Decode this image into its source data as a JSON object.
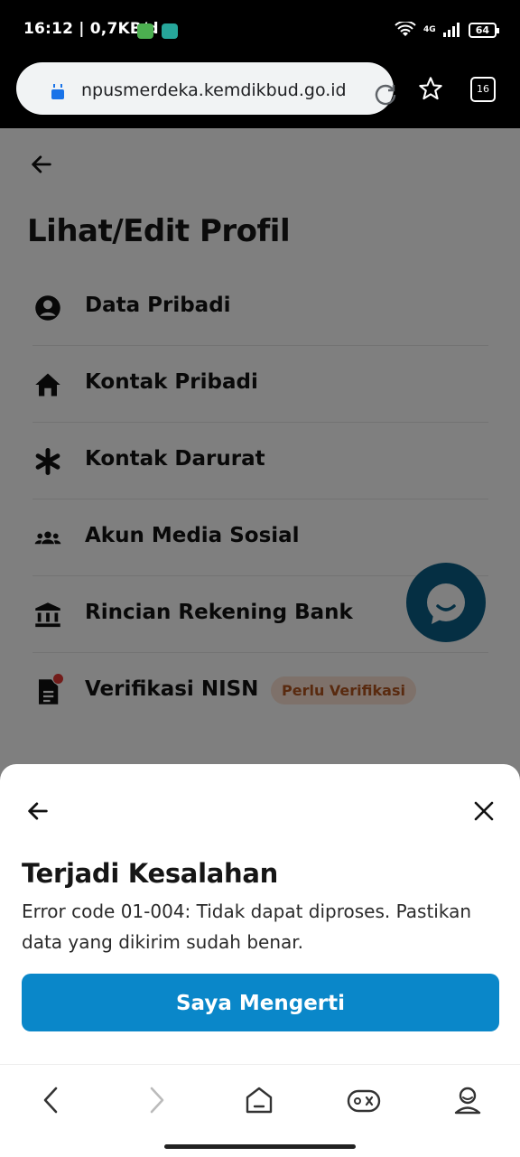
{
  "status_bar": {
    "time": "16:12 | 0,7KB/d",
    "network": "4G",
    "battery": "64"
  },
  "browser": {
    "url": "npusmerdeka.kemdikbud.go.id",
    "tab_count": "16"
  },
  "page": {
    "title": "Lihat/Edit Profil",
    "menu": [
      {
        "label": "Data Pribadi",
        "icon": "person-circle-icon"
      },
      {
        "label": "Kontak Pribadi",
        "icon": "home-icon"
      },
      {
        "label": "Kontak Darurat",
        "icon": "asterisk-icon"
      },
      {
        "label": "Akun Media Sosial",
        "icon": "people-group-icon"
      },
      {
        "label": "Rincian Rekening Bank",
        "icon": "bank-icon"
      },
      {
        "label": "Verifikasi NISN",
        "icon": "document-icon",
        "badge": "Perlu Verifikasi"
      }
    ]
  },
  "dialog": {
    "title": "Terjadi Kesalahan",
    "message": "Error code 01-004: Tidak dapat diproses. Pastikan data yang dikirim sudah benar.",
    "confirm_label": "Saya Mengerti"
  },
  "colors": {
    "primary": "#0a87c9",
    "chat_fab": "#0b5f86",
    "badge_bg": "#fde2d4",
    "badge_text": "#b2541f"
  }
}
